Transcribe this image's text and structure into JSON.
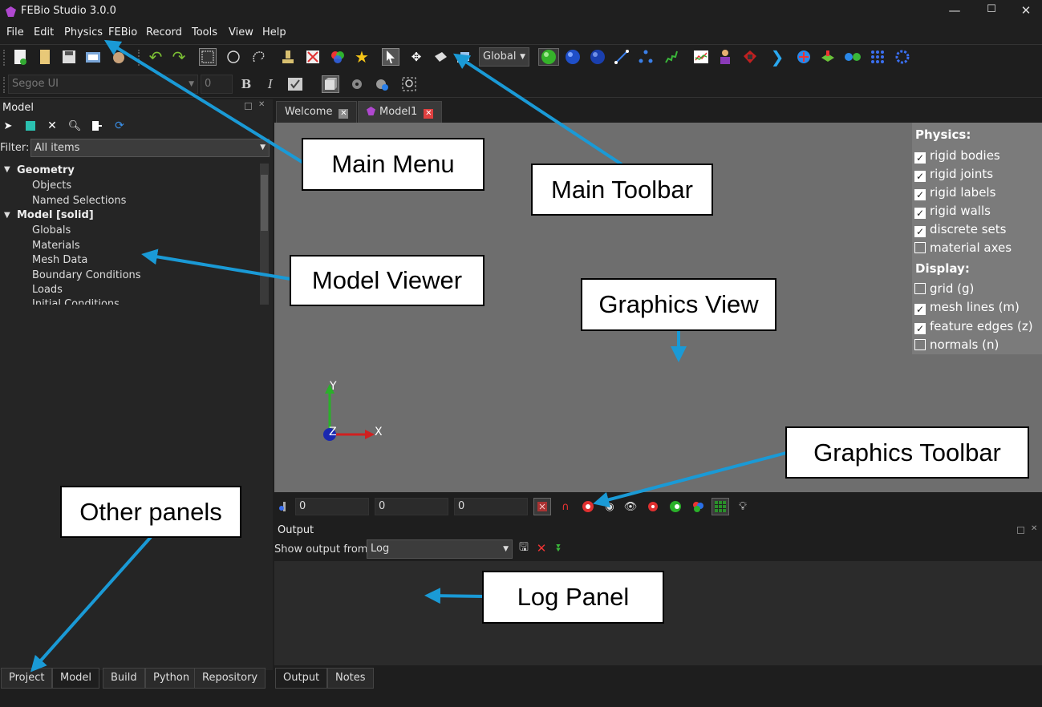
{
  "window": {
    "title": "FEBio Studio 3.0.0",
    "min": "—",
    "max": "☐",
    "close": "✕"
  },
  "menu": [
    "File",
    "Edit",
    "Physics",
    "FEBio",
    "Record",
    "Tools",
    "View",
    "Help"
  ],
  "toolbar": {
    "icons": [
      "new-file-icon",
      "open-file-icon",
      "save-icon",
      "snapshot-icon",
      "hand-icon",
      "undo-icon",
      "redo-icon",
      "rect-select-icon",
      "circle-select-icon",
      "freehand-select-icon",
      "stamp-icon",
      "stamp-cancel-icon",
      "color-map-icon",
      "star-icon",
      "select-arrow-icon",
      "move-icon",
      "rotate-icon",
      "scale-icon"
    ],
    "coord_system": "Global",
    "shape_icons": [
      "sphere-green-icon",
      "sphere-blue-icon",
      "cube-blue-icon",
      "line-icon",
      "points-icon",
      "spring-icon",
      "chart-icon",
      "person-icon",
      "stamp-red-icon",
      "arrow-icon",
      "mesh-icon",
      "plane-icon",
      "link-icon",
      "grid-icon",
      "ring-icon"
    ]
  },
  "format_toolbar": {
    "font": "Segoe UI",
    "size": "0",
    "bold": "B",
    "italic": "I"
  },
  "model_panel": {
    "title": "Model",
    "filter_label": "Filter:",
    "filter_value": "All items",
    "tree": [
      {
        "label": "Geometry",
        "level": 0,
        "bold": true
      },
      {
        "label": "Objects",
        "level": 1
      },
      {
        "label": "Named Selections",
        "level": 1
      },
      {
        "label": "Model [solid]",
        "level": 0,
        "bold": true
      },
      {
        "label": "Globals",
        "level": 1
      },
      {
        "label": "Materials",
        "level": 1
      },
      {
        "label": "Mesh Data",
        "level": 1
      },
      {
        "label": "Boundary Conditions",
        "level": 1
      },
      {
        "label": "Loads",
        "level": 1
      },
      {
        "label": "Initial Conditions",
        "level": 1
      }
    ]
  },
  "doc_tabs": [
    "Welcome",
    "Model1"
  ],
  "overlay": {
    "physics_title": "Physics:",
    "physics": [
      {
        "label": "rigid bodies",
        "checked": true
      },
      {
        "label": "rigid joints",
        "checked": true
      },
      {
        "label": "rigid labels",
        "checked": true
      },
      {
        "label": "rigid walls",
        "checked": true
      },
      {
        "label": "discrete sets",
        "checked": true
      },
      {
        "label": "material axes",
        "checked": false
      }
    ],
    "display_title": "Display:",
    "display": [
      {
        "label": "grid (g)",
        "checked": false
      },
      {
        "label": "mesh lines (m)",
        "checked": true
      },
      {
        "label": "feature edges (z)",
        "checked": true
      },
      {
        "label": "normals (n)",
        "checked": false
      }
    ]
  },
  "axes": {
    "x": "X",
    "y": "Y",
    "z": "Z"
  },
  "graphics_toolbar": {
    "coords": [
      "0",
      "0",
      "0"
    ]
  },
  "output": {
    "title": "Output",
    "show_label": "Show output from:",
    "source": "Log"
  },
  "left_tabs": [
    "Project",
    "Model",
    "Build",
    "Python",
    "Repository"
  ],
  "bottom_tabs": [
    "Output",
    "Notes"
  ],
  "callouts": {
    "main_menu": "Main Menu",
    "main_toolbar": "Main Toolbar",
    "model_viewer": "Model Viewer",
    "graphics_view": "Graphics View",
    "graphics_toolbar": "Graphics Toolbar",
    "other_panels": "Other panels",
    "log_panel": "Log Panel"
  },
  "colors": {
    "callout_arrow": "#1a9ad6",
    "accent_red": "#e04040"
  }
}
